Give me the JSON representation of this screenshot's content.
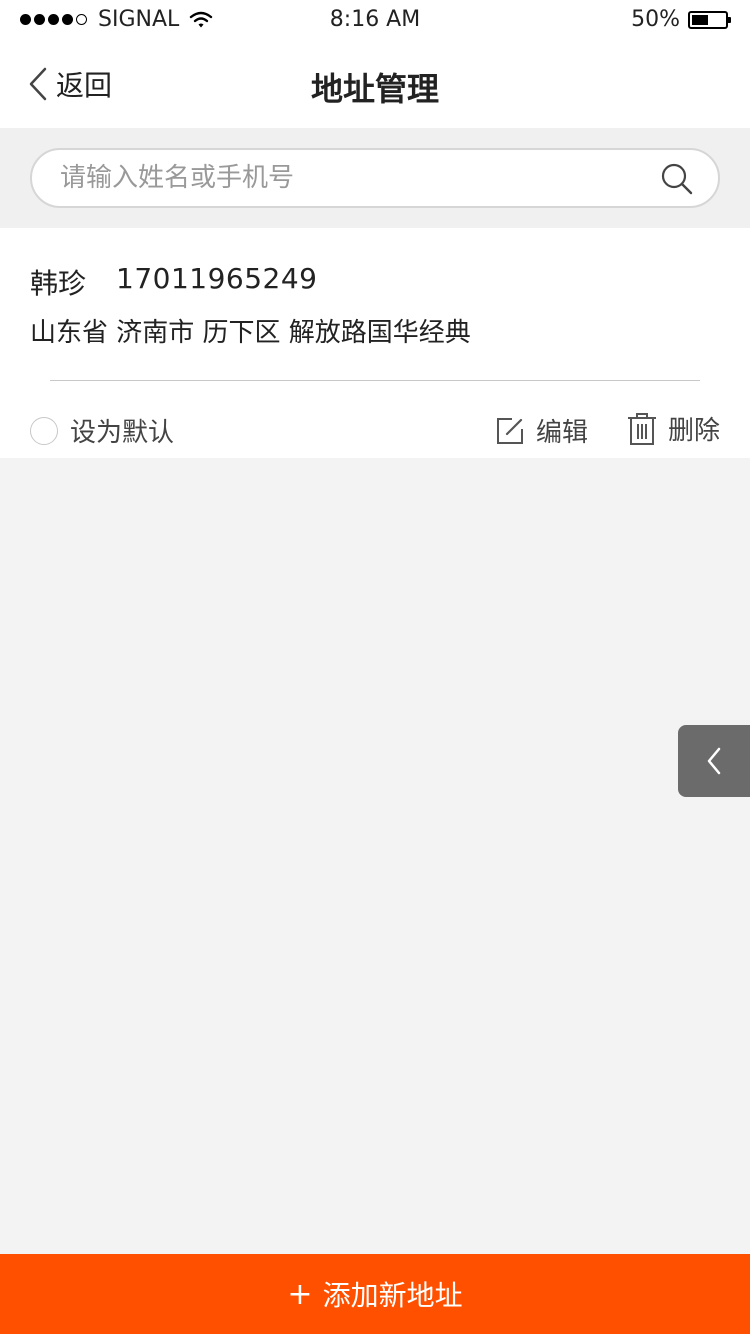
{
  "status_bar": {
    "carrier": "SIGNAL",
    "time": "8:16 AM",
    "battery": "50%",
    "battery_level": 0.5
  },
  "nav": {
    "back_label": "返回",
    "title": "地址管理"
  },
  "search": {
    "placeholder": "请输入姓名或手机号",
    "value": ""
  },
  "address": {
    "name": "韩珍",
    "phone": "17011965249",
    "detail": "山东省 济南市 历下区 解放路国华经典",
    "default_label": "设为默认",
    "edit_label": "编辑",
    "delete_label": "删除"
  },
  "footer": {
    "add_plus": "+",
    "add_label": "添加新地址"
  },
  "colors": {
    "accent": "#ff5000",
    "side_tab": "#6b6b6b"
  },
  "icons": {
    "back": "chevron-left-icon",
    "search": "search-icon",
    "edit": "edit-icon",
    "delete": "trash-icon",
    "side_tab": "chevron-left-icon",
    "wifi": "wifi-icon",
    "battery": "battery-icon"
  }
}
